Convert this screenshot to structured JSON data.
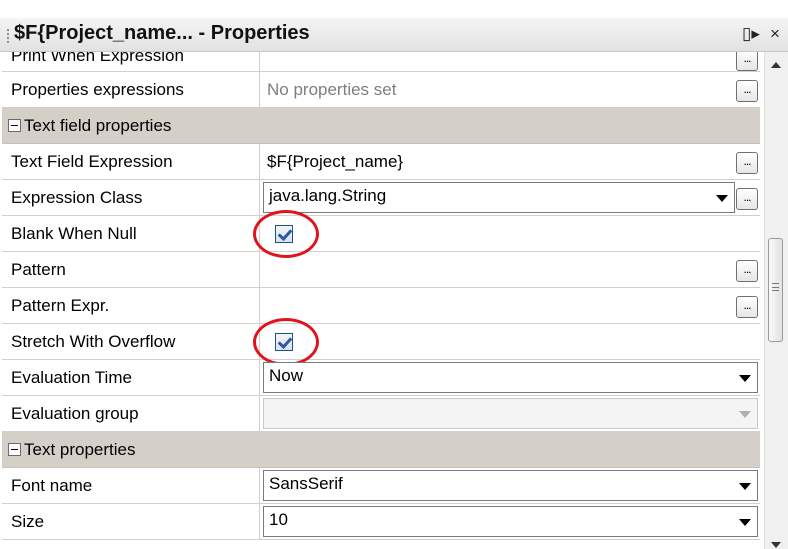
{
  "window": {
    "title": "$F{Project_name... - Properties",
    "restore_glyph": "▯▸",
    "close_glyph": "×"
  },
  "rows": {
    "print_when_expression": {
      "name": "Print When Expression",
      "button": "..."
    },
    "properties_expressions": {
      "name": "Properties expressions",
      "value": "No properties set",
      "button": "..."
    },
    "section_text_field": {
      "label": "Text field properties"
    },
    "text_field_expression": {
      "name": "Text Field Expression",
      "value": "$F{Project_name}",
      "button": "..."
    },
    "expression_class": {
      "name": "Expression Class",
      "value": "java.lang.String",
      "button": "..."
    },
    "blank_when_null": {
      "name": "Blank When Null",
      "checked": true
    },
    "pattern": {
      "name": "Pattern",
      "button": "..."
    },
    "pattern_expr": {
      "name": "Pattern Expr.",
      "button": "..."
    },
    "stretch_with_overflow": {
      "name": "Stretch With Overflow",
      "checked": true
    },
    "evaluation_time": {
      "name": "Evaluation Time",
      "value": "Now"
    },
    "evaluation_group": {
      "name": "Evaluation group",
      "value": ""
    },
    "section_text": {
      "label": "Text properties"
    },
    "font_name": {
      "name": "Font name",
      "value": "SansSerif"
    },
    "size": {
      "name": "Size",
      "value": "10"
    }
  },
  "colors": {
    "section_bg": "#d4d0c8",
    "highlight_circle": "#e0141e",
    "checkbox_check": "#2b57a8"
  }
}
